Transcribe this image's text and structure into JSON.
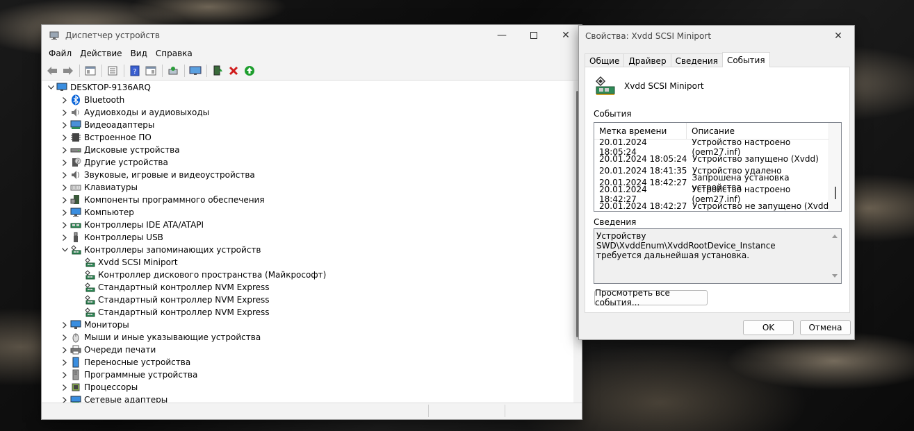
{
  "device_manager": {
    "title": "Диспетчер устройств",
    "menu": [
      "Файл",
      "Действие",
      "Вид",
      "Справка"
    ],
    "tree": {
      "root": "DESKTOP-9136ARQ",
      "categories": [
        {
          "label": "Bluetooth",
          "icon": "bluetooth-icon",
          "expanded": false
        },
        {
          "label": "Аудиовходы и аудиовыходы",
          "icon": "speaker-icon",
          "expanded": false
        },
        {
          "label": "Видеоадаптеры",
          "icon": "display-adapter-icon",
          "expanded": false
        },
        {
          "label": "Встроенное ПО",
          "icon": "firmware-icon",
          "expanded": false
        },
        {
          "label": "Дисковые устройства",
          "icon": "disk-drive-icon",
          "expanded": false
        },
        {
          "label": "Другие устройства",
          "icon": "unknown-device-icon",
          "expanded": false
        },
        {
          "label": "Звуковые, игровые и видеоустройства",
          "icon": "sound-icon",
          "expanded": false
        },
        {
          "label": "Клавиатуры",
          "icon": "keyboard-icon",
          "expanded": false
        },
        {
          "label": "Компоненты программного обеспечения",
          "icon": "software-component-icon",
          "expanded": false
        },
        {
          "label": "Компьютер",
          "icon": "computer-icon",
          "expanded": false
        },
        {
          "label": "Контроллеры IDE ATA/ATAPI",
          "icon": "ide-controller-icon",
          "expanded": false
        },
        {
          "label": "Контроллеры USB",
          "icon": "usb-icon",
          "expanded": false
        },
        {
          "label": "Контроллеры запоминающих устройств",
          "icon": "storage-controller-icon",
          "expanded": true,
          "children": [
            "Xvdd SCSI Miniport",
            "Контроллер дискового пространства (Майкрософт)",
            "Стандартный контроллер NVM Express",
            "Стандартный контроллер NVM Express",
            "Стандартный контроллер NVM Express"
          ]
        },
        {
          "label": "Мониторы",
          "icon": "monitor-icon",
          "expanded": false
        },
        {
          "label": "Мыши и иные указывающие устройства",
          "icon": "mouse-icon",
          "expanded": false
        },
        {
          "label": "Очереди печати",
          "icon": "printer-icon",
          "expanded": false
        },
        {
          "label": "Переносные устройства",
          "icon": "portable-device-icon",
          "expanded": false
        },
        {
          "label": "Программные устройства",
          "icon": "software-device-icon",
          "expanded": false
        },
        {
          "label": "Процессоры",
          "icon": "processor-icon",
          "expanded": false
        },
        {
          "label": "Сетевые адаптеры",
          "icon": "network-adapter-icon",
          "expanded": false
        }
      ]
    }
  },
  "properties": {
    "title": "Свойства: Xvdd SCSI Miniport",
    "tabs": [
      "Общие",
      "Драйвер",
      "Сведения",
      "События"
    ],
    "active_tab": "События",
    "device_name": "Xvdd SCSI Miniport",
    "events_label": "События",
    "columns": [
      "Метка времени",
      "Описание"
    ],
    "events": [
      {
        "time": "20.01.2024 18:05:24",
        "desc": "Устройство настроено (oem27.inf)"
      },
      {
        "time": "20.01.2024 18:05:24",
        "desc": "Устройство запущено (Xvdd)"
      },
      {
        "time": "20.01.2024 18:41:35",
        "desc": "Устройство удалено"
      },
      {
        "time": "20.01.2024 18:42:27",
        "desc": "Запрошена установка устройства"
      },
      {
        "time": "20.01.2024 18:42:27",
        "desc": "Устройство настроено (oem27.inf)"
      },
      {
        "time": "20.01.2024 18:42:27",
        "desc": "Устройство не запущено (Xvdd)"
      }
    ],
    "info_label": "Сведения",
    "info_text": "Устройству SWD\\XvddEnum\\XvddRootDevice_Instance требуется дальнейшая установка.",
    "view_all_button": "Просмотреть все события...",
    "ok_button": "OK",
    "cancel_button": "Отмена"
  },
  "colors": {
    "bluetooth": "#0a64d8",
    "remove_red": "#d01c1c",
    "update_green": "#1e9e2e",
    "help_blue": "#3a5fd0"
  }
}
